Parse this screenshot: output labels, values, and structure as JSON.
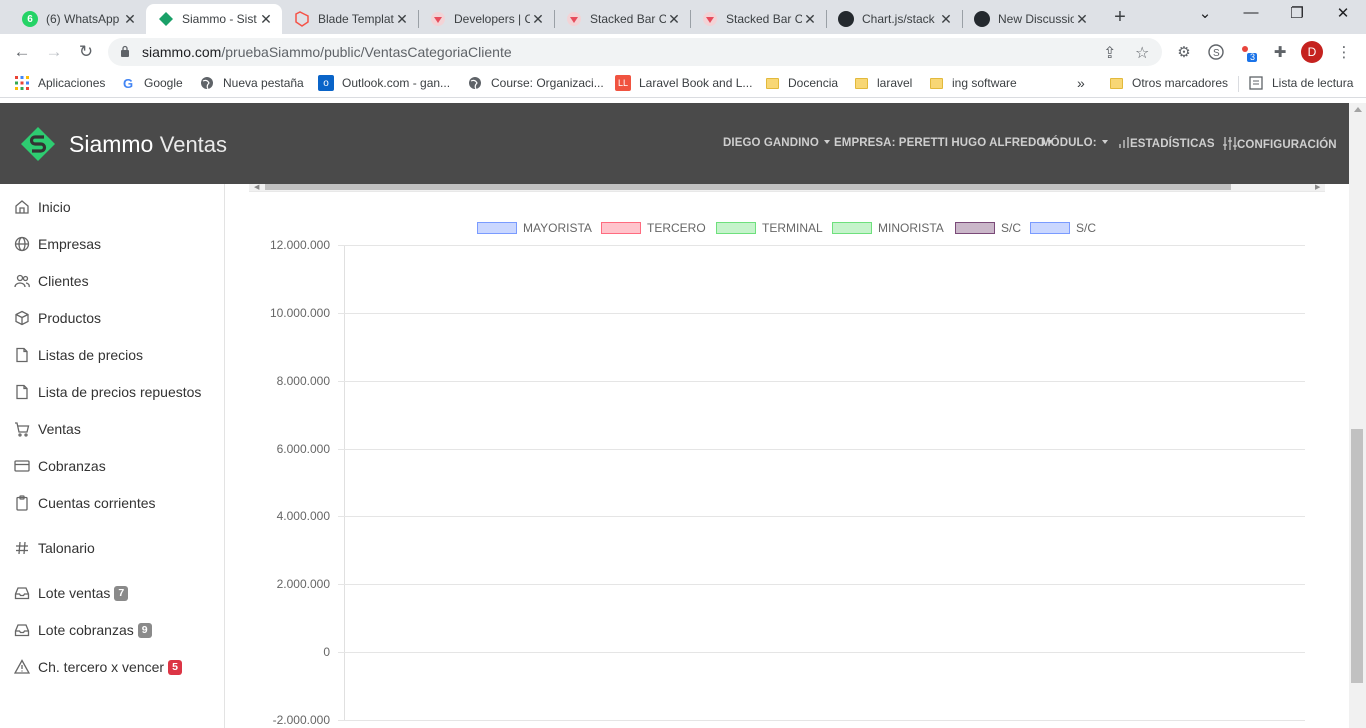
{
  "browser": {
    "tabs": [
      {
        "title": "(6) WhatsApp",
        "favicon_color": "#25d366",
        "favicon_text": "6"
      },
      {
        "title": "Siammo - Sist",
        "favicon_color": "#1aa068",
        "favicon_text": ""
      },
      {
        "title": "Blade Templat",
        "favicon_color": "#f55247",
        "favicon_text": ""
      },
      {
        "title": "Developers | C",
        "favicon_color": "#e74c5c",
        "favicon_text": ""
      },
      {
        "title": "Stacked Bar C",
        "favicon_color": "#e74c5c",
        "favicon_text": ""
      },
      {
        "title": "Stacked Bar C",
        "favicon_color": "#e74c5c",
        "favicon_text": ""
      },
      {
        "title": "Chart.js/stack",
        "favicon_color": "#24292e",
        "favicon_text": ""
      },
      {
        "title": "New Discussio",
        "favicon_color": "#24292e",
        "favicon_text": ""
      }
    ],
    "close_glyph": "✕",
    "new_tab_glyph": "+",
    "url_domain": "siammo.com",
    "url_path": "/pruebaSiammo/public/VentasCategoriaCliente",
    "extension_badge": "3",
    "profile_initial": "D",
    "bookmarks": [
      {
        "label": "Aplicaciones",
        "icon": "apps-grid-icon"
      },
      {
        "label": "Google",
        "icon": "google-icon"
      },
      {
        "label": "Nueva pestaña",
        "icon": "globe-icon"
      },
      {
        "label": "Outlook.com - gan...",
        "icon": "outlook-icon"
      },
      {
        "label": "Course: Organizaci...",
        "icon": "globe-icon"
      },
      {
        "label": "Laravel Book and L...",
        "icon": "laravel-icon"
      },
      {
        "label": "Docencia",
        "icon": "folder-icon"
      },
      {
        "label": "laravel",
        "icon": "folder-icon"
      },
      {
        "label": "ing software",
        "icon": "folder-icon"
      }
    ],
    "overflow_glyph": "»",
    "other_bookmarks": "Otros marcadores",
    "reading_list": "Lista de lectura"
  },
  "app": {
    "brand": "Siammo",
    "brand_sub": "Ventas",
    "brand_color": "#2ecc71",
    "nav": {
      "user": "DIEGO GANDINO",
      "company": "EMPRESA: PERETTI HUGO ALFREDO",
      "module": "MÓDULO:",
      "stats": "ESTADÍSTICAS",
      "config": "CONFIGURACIÓN"
    },
    "sidebar": [
      {
        "label": "Inicio",
        "icon": "home-icon"
      },
      {
        "label": "Empresas",
        "icon": "globe-icon"
      },
      {
        "label": "Clientes",
        "icon": "users-icon"
      },
      {
        "label": "Productos",
        "icon": "box-icon"
      },
      {
        "label": "Listas de precios",
        "icon": "file-icon"
      },
      {
        "label": "Lista de precios repuestos",
        "icon": "file-icon"
      },
      {
        "label": "Ventas",
        "icon": "cart-icon"
      },
      {
        "label": "Cobranzas",
        "icon": "credit-card-icon"
      },
      {
        "label": "Cuentas corrientes",
        "icon": "clipboard-icon"
      },
      {
        "label": "Talonario",
        "icon": "hash-icon"
      },
      {
        "label": "Lote ventas",
        "icon": "inbox-icon",
        "badge": "7"
      },
      {
        "label": "Lote cobranzas",
        "icon": "inbox-icon",
        "badge": "9"
      },
      {
        "label": "Ch. tercero x vencer",
        "icon": "alert-triangle-icon",
        "badge": "5"
      }
    ]
  },
  "chart_data": {
    "type": "bar",
    "stacked": true,
    "series": [
      {
        "name": "MAYORISTA",
        "color": "#7a9bff",
        "values": []
      },
      {
        "name": "TERCERO",
        "color": "#ff6b7f",
        "values": []
      },
      {
        "name": "TERMINAL",
        "color": "#6ee07d",
        "values": []
      },
      {
        "name": "MINORISTA",
        "color": "#6ee07d",
        "values": []
      },
      {
        "name": "S/C",
        "color": "#7a4a78",
        "values": []
      },
      {
        "name": "S/C",
        "color": "#7a9bff",
        "values": []
      }
    ],
    "categories": [],
    "yticks": [
      "12.000.000",
      "10.000.000",
      "8.000.000",
      "6.000.000",
      "4.000.000",
      "2.000.000",
      "0",
      "-2.000.000"
    ],
    "ylim": [
      -2000000,
      12000000
    ],
    "grid": true,
    "legend_position": "top"
  }
}
